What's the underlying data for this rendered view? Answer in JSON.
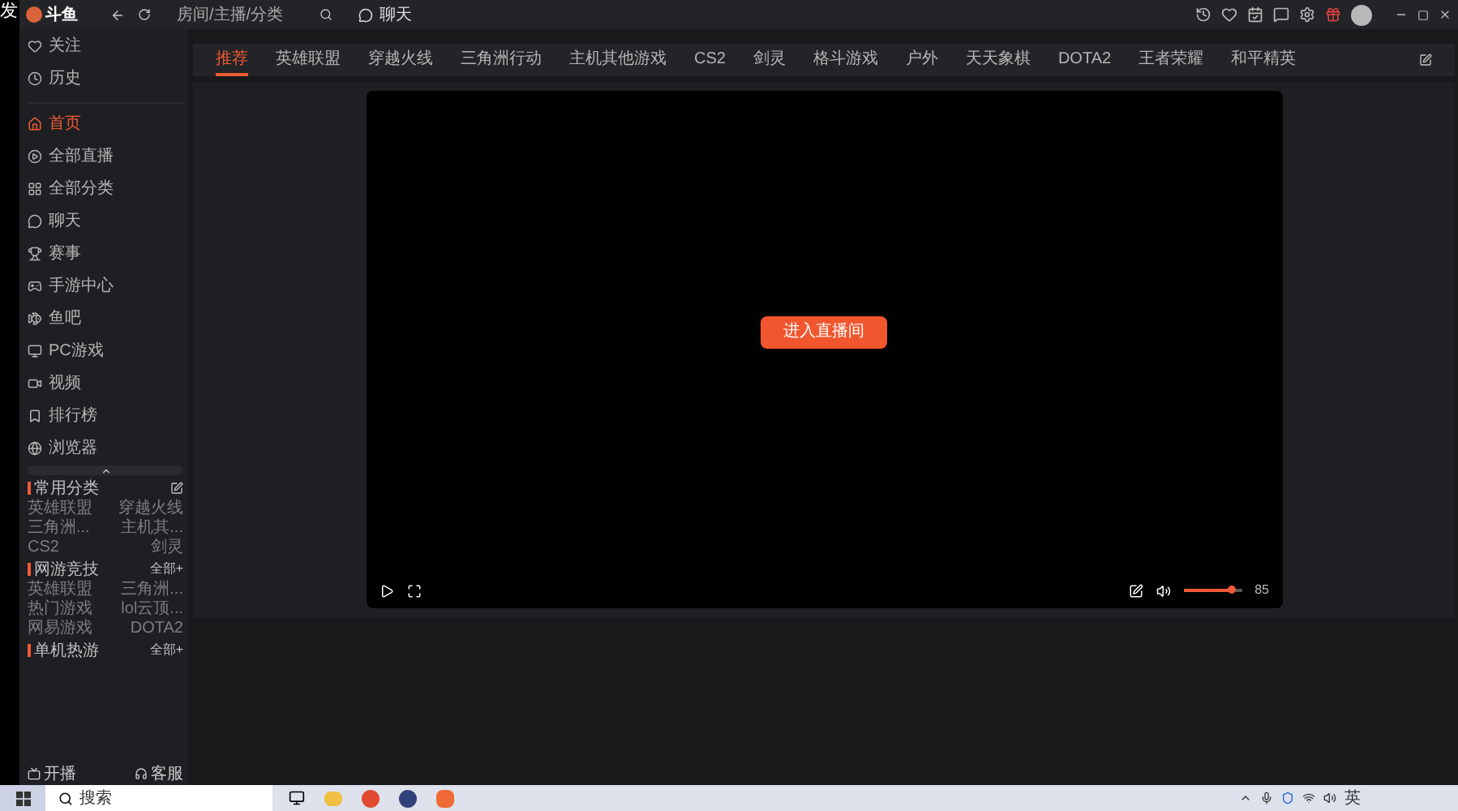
{
  "corner_text": "发",
  "topbar": {
    "logo": "斗鱼",
    "search": {
      "placeholder": "房间/主播/分类"
    },
    "chat_button": "聊天"
  },
  "sidebar": {
    "items": [
      {
        "label": "关注",
        "selected": false
      },
      {
        "label": "历史",
        "selected": false
      },
      {
        "label": "首页",
        "selected": true
      },
      {
        "label": "全部直播",
        "selected": false
      },
      {
        "label": "全部分类",
        "selected": false
      },
      {
        "label": "聊天",
        "selected": false
      },
      {
        "label": "赛事",
        "selected": false
      },
      {
        "label": "手游中心",
        "selected": false
      },
      {
        "label": "鱼吧",
        "selected": false
      },
      {
        "label": "PC游戏",
        "selected": false
      },
      {
        "label": "视频",
        "selected": false
      },
      {
        "label": "排行榜",
        "selected": false
      },
      {
        "label": "浏览器",
        "selected": false
      }
    ],
    "sections": [
      {
        "title": "常用分类",
        "kind": "edit",
        "items": [
          "英雄联盟",
          "穿越火线",
          "三角洲...",
          "主机其...",
          "CS2",
          "剑灵"
        ]
      },
      {
        "title": "网游竞技",
        "kind": "more",
        "more": "全部+",
        "items": [
          "英雄联盟",
          "三角洲...",
          "热门游戏",
          "lol云顶...",
          "网易游戏",
          "DOTA2"
        ]
      },
      {
        "title": "单机热游",
        "kind": "more",
        "more": "全部+"
      }
    ],
    "footer": [
      "开播",
      "客服"
    ]
  },
  "tabs": [
    {
      "label": "推荐",
      "selected": true
    },
    {
      "label": "英雄联盟",
      "selected": false
    },
    {
      "label": "穿越火线",
      "selected": false
    },
    {
      "label": "三角洲行动",
      "selected": false
    },
    {
      "label": "主机其他游戏",
      "selected": false
    },
    {
      "label": "CS2",
      "selected": false
    },
    {
      "label": "剑灵",
      "selected": false
    },
    {
      "label": "格斗游戏",
      "selected": false
    },
    {
      "label": "户外",
      "selected": false
    },
    {
      "label": "天天象棋",
      "selected": false
    },
    {
      "label": "DOTA2",
      "selected": false
    },
    {
      "label": "王者荣耀",
      "selected": false
    },
    {
      "label": "和平精英",
      "selected": false
    }
  ],
  "player": {
    "enter_button": "进入直播间",
    "volume": {
      "level": 0.82,
      "reading": "85"
    }
  },
  "taskbar": {
    "search": {
      "placeholder": "搜索"
    },
    "input_method": "英"
  }
}
